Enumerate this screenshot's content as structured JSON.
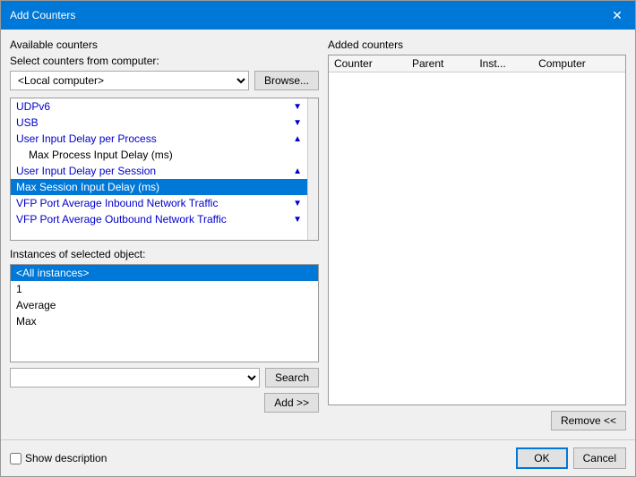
{
  "dialog": {
    "title": "Add Counters",
    "close_label": "✕"
  },
  "left": {
    "available_counters_label": "Available counters",
    "select_from_label": "Select counters from computer:",
    "computer_value": "<Local computer>",
    "browse_label": "Browse...",
    "counter_items": [
      {
        "id": "udpv6",
        "label": "UDPv6",
        "type": "expandable",
        "icon": "▼",
        "selected": false
      },
      {
        "id": "usb",
        "label": "USB",
        "type": "expandable",
        "icon": "▼",
        "selected": false
      },
      {
        "id": "user-input-per-process",
        "label": "User Input Delay per Process",
        "type": "collapsible",
        "icon": "▲",
        "selected": false
      },
      {
        "id": "max-process-delay",
        "label": "Max Process Input Delay (ms)",
        "type": "sub",
        "selected": false
      },
      {
        "id": "user-input-per-session",
        "label": "User Input Delay per Session",
        "type": "collapsible",
        "icon": "▲",
        "selected": false
      },
      {
        "id": "max-session-delay",
        "label": "Max Session Input Delay (ms)",
        "type": "sub",
        "selected": true
      },
      {
        "id": "vfp-inbound",
        "label": "VFP Port Average Inbound Network Traffic",
        "type": "expandable",
        "icon": "▼",
        "selected": false
      },
      {
        "id": "vfp-outbound",
        "label": "VFP Port Average Outbound Network Traffic",
        "type": "expandable",
        "icon": "▼",
        "selected": false
      }
    ],
    "instances_label": "Instances of selected object:",
    "instances": [
      {
        "id": "all",
        "label": "<All instances>",
        "selected": true
      },
      {
        "id": "1",
        "label": "1",
        "selected": false
      },
      {
        "id": "average",
        "label": "Average",
        "selected": false
      },
      {
        "id": "max",
        "label": "Max",
        "selected": false
      }
    ],
    "search_label": "Search",
    "add_label": "Add >>"
  },
  "right": {
    "added_counters_label": "Added counters",
    "table_headers": [
      "Counter",
      "Parent",
      "Inst...",
      "Computer"
    ],
    "remove_label": "Remove <<"
  },
  "bottom": {
    "show_description_label": "Show description",
    "ok_label": "OK",
    "cancel_label": "Cancel"
  }
}
